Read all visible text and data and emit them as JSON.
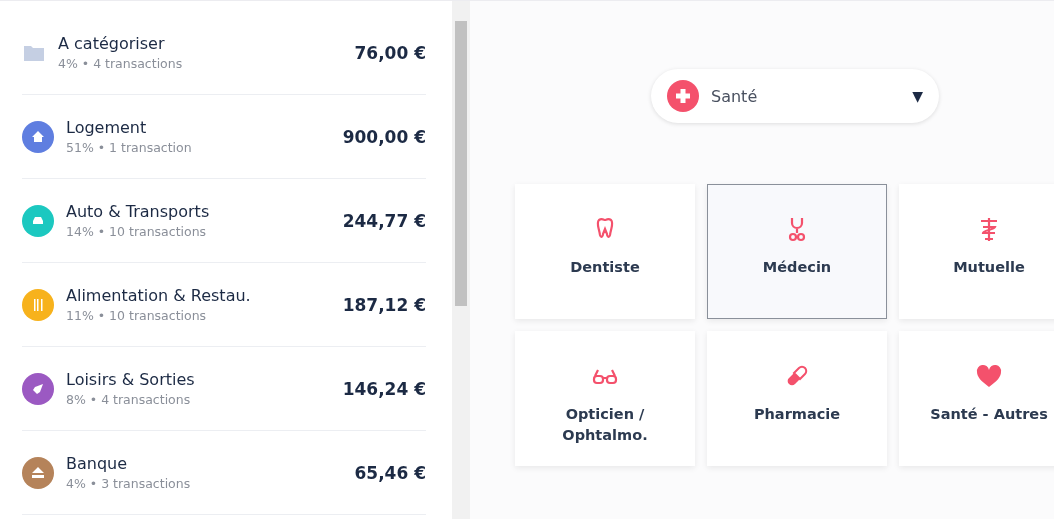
{
  "categories": [
    {
      "name": "A catégoriser",
      "detail": "4% • 4 transactions",
      "amount": "76,00 €",
      "kind": "folder",
      "color": "#c5cfe3"
    },
    {
      "name": "Logement",
      "detail": "51% • 1 transaction",
      "amount": "900,00 €",
      "kind": "home",
      "color": "#5f7ee0"
    },
    {
      "name": "Auto & Transports",
      "detail": "14% • 10 transactions",
      "amount": "244,77 €",
      "kind": "car",
      "color": "#1cc8c0"
    },
    {
      "name": "Alimentation & Restau.",
      "detail": "11% • 10 transactions",
      "amount": "187,12 €",
      "kind": "food",
      "color": "#f7b21c"
    },
    {
      "name": "Loisirs & Sorties",
      "detail": "8% • 4 transactions",
      "amount": "146,24 €",
      "kind": "rocket",
      "color": "#9b59c2"
    },
    {
      "name": "Banque",
      "detail": "4% • 3 transactions",
      "amount": "65,46 €",
      "kind": "bank",
      "color": "#b5835a"
    }
  ],
  "category_select": {
    "value": "Santé",
    "caret": "▼"
  },
  "subcategories": [
    {
      "label": "Dentiste",
      "kind": "tooth",
      "selected": false
    },
    {
      "label": "Médecin",
      "kind": "stethoscope",
      "selected": true
    },
    {
      "label": "Mutuelle",
      "kind": "caduceus",
      "selected": false
    },
    {
      "label": "Opticien / Ophtalmo.",
      "kind": "glasses",
      "selected": false
    },
    {
      "label": "Pharmacie",
      "kind": "pill",
      "selected": false
    },
    {
      "label": "Santé - Autres",
      "kind": "heart",
      "selected": false
    }
  ]
}
